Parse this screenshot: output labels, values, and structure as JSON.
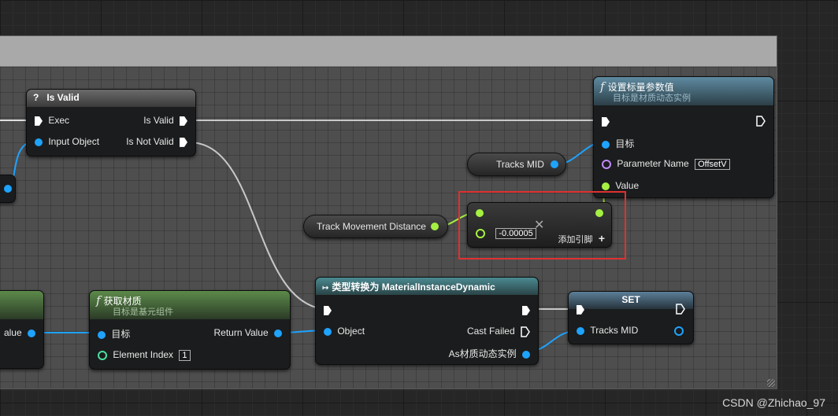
{
  "colors": {
    "exec": "#ffffff",
    "object_pin": "#1ea3ff",
    "float_pin": "#a5f041",
    "name_pin": "#c08bff",
    "highlight": "#e03030"
  },
  "nodes": {
    "is_valid": {
      "icon": "question-icon",
      "title": "Is Valid",
      "exec_in": "Exec",
      "input_object": "Input Object",
      "out_valid": "Is Valid",
      "out_not_valid": "Is Not Valid"
    },
    "set_scalar": {
      "icon": "function-icon",
      "title": "设置标量参数值",
      "subtitle": "目标是材质动态实例",
      "target": "目标",
      "param_name_label": "Parameter Name",
      "param_name_value": "OffsetV",
      "value": "Value"
    },
    "tracks_mid_getter": {
      "label": "Tracks MID"
    },
    "track_move_getter": {
      "label": "Track Movement Distance"
    },
    "add_node": {
      "value": "-0.00005",
      "add_pin": "添加引脚",
      "close_icon": "close-icon",
      "plus_icon": "plus-icon"
    },
    "left_partial": {
      "return_value_suffix": "alue"
    },
    "get_material": {
      "icon": "function-icon",
      "title": "获取材质",
      "subtitle": "目标是基元组件",
      "target": "目标",
      "element_index": "Element Index",
      "element_index_value": "1",
      "return_value": "Return Value"
    },
    "cast": {
      "icon": "cast-icon",
      "title": "类型转换为 MaterialInstanceDynamic",
      "object": "Object",
      "cast_failed": "Cast Failed",
      "as_out": "As材质动态实例"
    },
    "set": {
      "title": "SET",
      "tracks_mid": "Tracks MID"
    }
  },
  "watermark": "CSDN @Zhichao_97"
}
